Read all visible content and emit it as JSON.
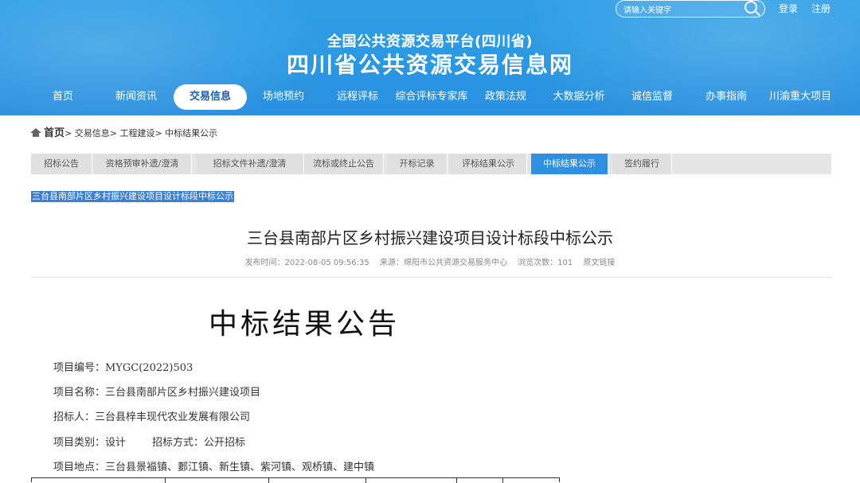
{
  "header": {
    "search_placeholder": "请输入关键字",
    "login": "登录",
    "register": "注册",
    "subtitle": "全国公共资源交易平台(四川省)",
    "title": "四川省公共资源交易信息网"
  },
  "nav": {
    "items": [
      "首页",
      "新闻资讯",
      "交易信息",
      "场地预约",
      "远程评标",
      "综合评标专家库",
      "政策法规",
      "大数据分析",
      "诚信监督",
      "办事指南",
      "川渝重大项目"
    ],
    "active": "交易信息"
  },
  "breadcrumb": {
    "home": "首页",
    "sep": ">",
    "items": [
      "交易信息",
      "工程建设",
      "中标结果公示"
    ]
  },
  "tabs": {
    "items": [
      "招标公告",
      "资格预审补遗/澄清",
      "招标文件补遗/澄清",
      "流标或终止公告",
      "开标记录",
      "评标结果公示",
      "中标结果公示",
      "签约履行"
    ],
    "active": "中标结果公示"
  },
  "selected_link": "三台县南部片区乡村振兴建设项目设计标段中标公示",
  "article": {
    "title": "三台县南部片区乡村振兴建设项目设计标段中标公示",
    "publish_time": "发布时间：2022-08-05 09:56:35",
    "source": "来源：绵阳市公共资源交易服务中心",
    "views": "浏览次数：101",
    "original_link": "原文链接"
  },
  "document": {
    "heading": "中标结果公告",
    "lines": [
      "项目编号：MYGC(2022)503",
      "项目名称：三台县南部片区乡村振兴建设项目",
      "招标人：三台县梓丰现代农业发展有限公司",
      "项目类别：设计        招标方式：公开招标",
      "项目地点：三台县景福镇、郪江镇、新生镇、紫河镇、观桥镇、建中镇"
    ]
  },
  "colors": {
    "header_blue": "#2b98e3",
    "active_tab": "#2f8fe0",
    "highlight": "#3b7fd4"
  }
}
